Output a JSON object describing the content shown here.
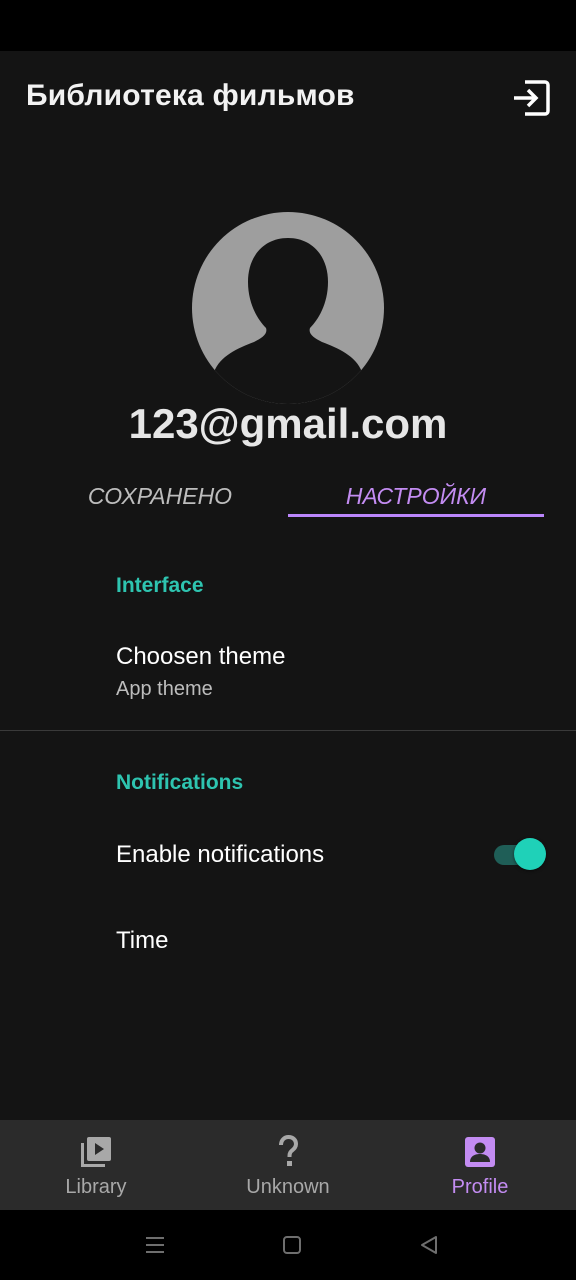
{
  "app_bar": {
    "title": "Библиотека фильмов",
    "logout_icon": "logout-icon"
  },
  "profile": {
    "avatar_icon": "person-silhouette-icon",
    "email": "123@gmail.com"
  },
  "tabs": [
    {
      "label": "СОХРАНЕНО",
      "selected": false
    },
    {
      "label": "НАСТРОЙКИ",
      "selected": true
    }
  ],
  "settings": {
    "interface": {
      "header": "Interface",
      "theme_title": "Choosen theme",
      "theme_summary": "App theme"
    },
    "notifications": {
      "header": "Notifications",
      "enable_title": "Enable notifications",
      "enable_value": true,
      "time_title": "Time"
    }
  },
  "bottom_nav": [
    {
      "label": "Library",
      "icon": "video-library-icon",
      "selected": false
    },
    {
      "label": "Unknown",
      "icon": "question-mark-icon",
      "selected": false
    },
    {
      "label": "Profile",
      "icon": "account-box-icon",
      "selected": true
    }
  ],
  "colors": {
    "background": "#141414",
    "accent_purple": "#bb86fc",
    "accent_teal": "#2ec4b0",
    "nav_background": "#2b2b2b"
  }
}
